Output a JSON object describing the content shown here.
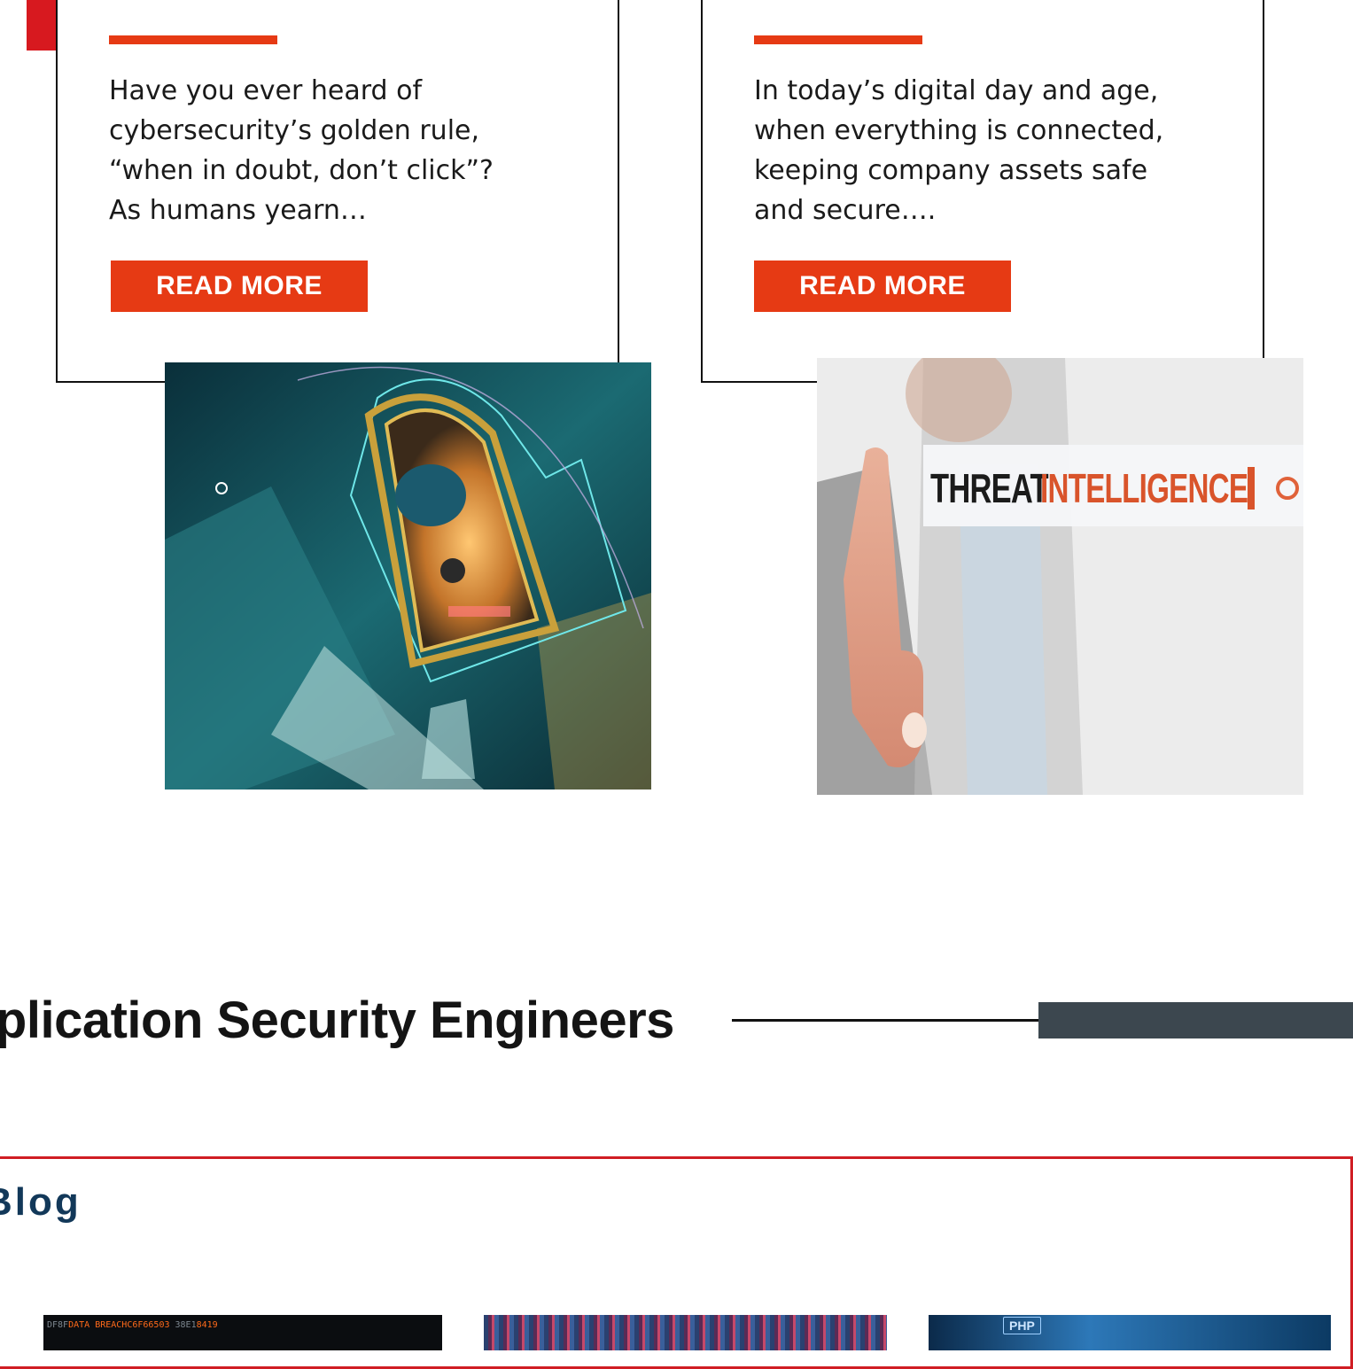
{
  "posts": [
    {
      "excerpt": "Have you ever heard of cybersecurity’s golden rule, “when in doubt, don’t click”? As humans yearn…",
      "cta": "READ MORE",
      "image": "padlock-cyber-image"
    },
    {
      "excerpt": "In today’s digital day and age, when everything is connected, keeping company assets safe and secure….",
      "cta": "READ MORE",
      "image": "threat-intelligence-image",
      "image_caption_word1": "THREAT",
      "image_caption_word2": "INTELLIGENCE"
    }
  ],
  "section": {
    "title": "pplication Security Engineers"
  },
  "blog": {
    "title": "Blog",
    "thumbs": [
      {
        "label_a": "DATA BREACH",
        "label_b": "C6F66503",
        "label_c": "8419"
      },
      {
        "label_a": ""
      },
      {
        "label_a": "PHP"
      }
    ]
  },
  "colors": {
    "accent": "#e63a14",
    "brand_red": "#d01e24",
    "navy": "#123859",
    "slate": "#3c474f"
  }
}
